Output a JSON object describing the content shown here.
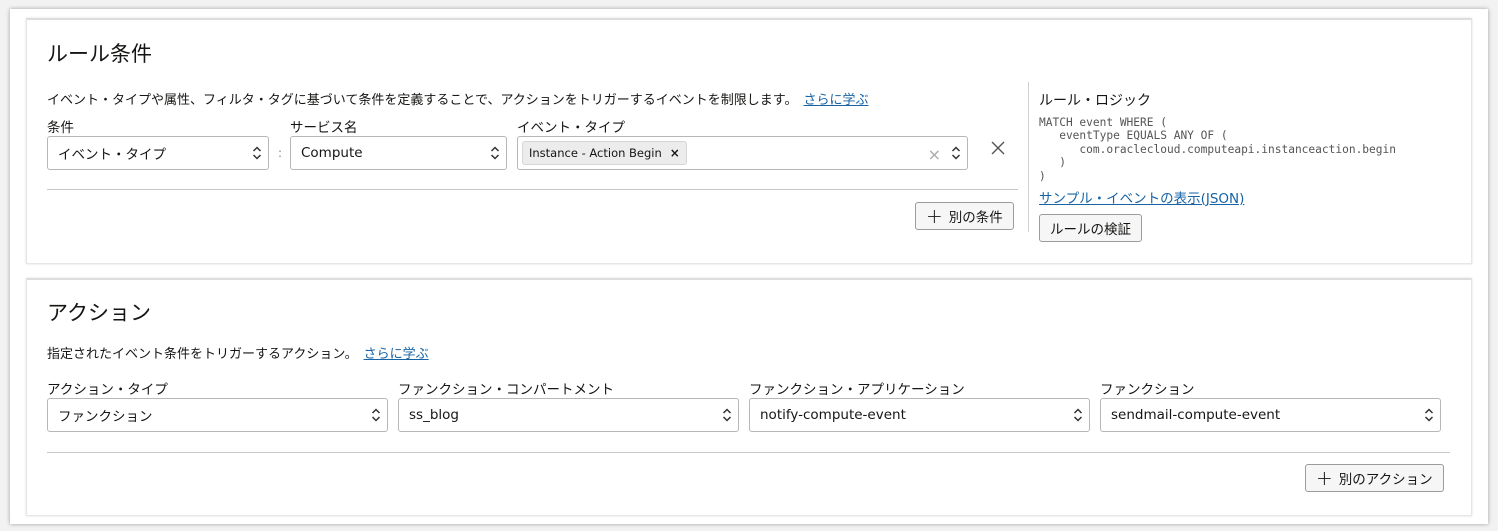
{
  "rule_conditions": {
    "title": "ルール条件",
    "description": "イベント・タイプや属性、フィルタ・タグに基づいて条件を定義することで、アクションをトリガーするイベントを制限します。",
    "learn_more": "さらに学ぶ",
    "condition_label": "条件",
    "condition_value": "イベント・タイプ",
    "service_label": "サービス名",
    "service_value": "Compute",
    "event_type_label": "イベント・タイプ",
    "event_type_chip": "Instance - Action Begin",
    "add_condition": "別の条件",
    "rule_logic_title": "ルール・ロジック",
    "rule_logic_code": "MATCH event WHERE (\n   eventType EQUALS ANY OF (\n      com.oraclecloud.computeapi.instanceaction.begin\n   )\n)",
    "sample_event_link": "サンプル・イベントの表示(JSON)",
    "validate_button": "ルールの検証"
  },
  "actions": {
    "title": "アクション",
    "description": "指定されたイベント条件をトリガーするアクション。",
    "learn_more": "さらに学ぶ",
    "action_type_label": "アクション・タイプ",
    "action_type_value": "ファンクション",
    "compartment_label": "ファンクション・コンパートメント",
    "compartment_value": "ss_blog",
    "application_label": "ファンクション・アプリケーション",
    "application_value": "notify-compute-event",
    "function_label": "ファンクション",
    "function_value": "sendmail-compute-event",
    "add_action": "別のアクション"
  },
  "icons": {
    "select_chevron": "chevron-updown-icon",
    "remove": "close-icon",
    "add": "plus-icon"
  },
  "colors": {
    "link": "#1763a6",
    "border": "#b9b6b3"
  }
}
